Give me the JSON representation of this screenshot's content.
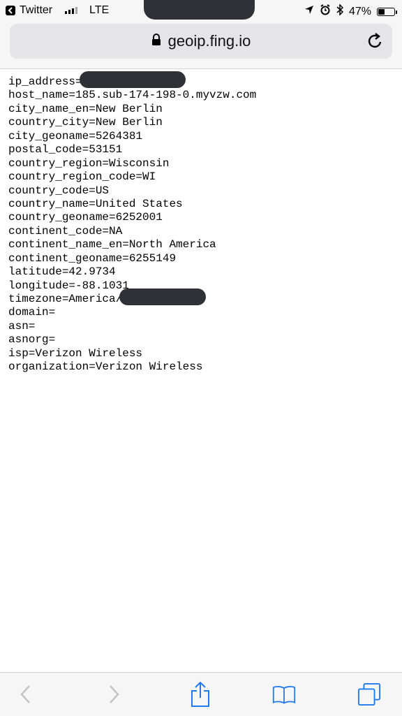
{
  "status_bar": {
    "back_app": "Twitter",
    "carrier": "LTE",
    "battery": "47%",
    "battery_level": 0.47
  },
  "url_bar": {
    "domain": "geoip.fing.io"
  },
  "content": {
    "lines": [
      {
        "text": "ip_address=",
        "redacted": true
      },
      {
        "text": "host_name=185.sub-174-198-0.myvzw.com"
      },
      {
        "text": "city_name_en=New Berlin"
      },
      {
        "text": "country_city=New Berlin"
      },
      {
        "text": "city_geoname=5264381"
      },
      {
        "text": "postal_code=53151"
      },
      {
        "text": "country_region=Wisconsin"
      },
      {
        "text": "country_region_code=WI"
      },
      {
        "text": "country_code=US"
      },
      {
        "text": "country_name=United States"
      },
      {
        "text": "country_geoname=6252001"
      },
      {
        "text": "continent_code=NA"
      },
      {
        "text": "continent_name_en=North America"
      },
      {
        "text": "continent_geoname=6255149"
      },
      {
        "text": "latitude=42.9734"
      },
      {
        "text": "longitude=-88.1031"
      },
      {
        "text": "timezone=America/",
        "redacted": true
      },
      {
        "text": "domain="
      },
      {
        "text": "asn="
      },
      {
        "text": "asnorg="
      },
      {
        "text": "isp=Verizon Wireless"
      },
      {
        "text": "organization=Verizon Wireless"
      }
    ]
  },
  "toolbar": {
    "icons": [
      "back-icon",
      "forward-icon",
      "share-icon",
      "bookmarks-icon",
      "tabs-icon"
    ]
  },
  "colors": {
    "ios_blue": "#1f7aef",
    "disabled": "#c4c4c8",
    "redaction": "#2e3236"
  }
}
